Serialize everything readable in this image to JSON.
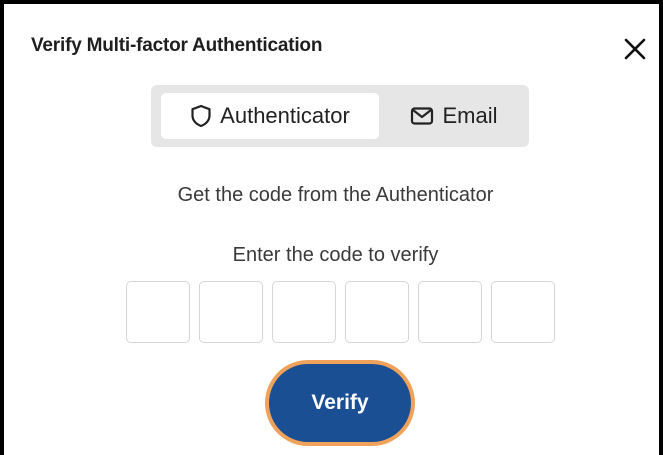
{
  "dialog": {
    "title": "Verify Multi-factor Authentication",
    "close_icon": "close-icon"
  },
  "method_tabs": [
    {
      "label": "Authenticator",
      "icon": "shield-icon",
      "selected": true
    },
    {
      "label": "Email",
      "icon": "mail-icon",
      "selected": false
    }
  ],
  "instructions": {
    "source_text": "Get the code from the Authenticator",
    "enter_text": "Enter the code to verify"
  },
  "code_inputs": [
    "",
    "",
    "",
    "",
    "",
    ""
  ],
  "verify_button": {
    "label": "Verify"
  },
  "colors": {
    "accent": "#1b4f93",
    "focus_ring": "#f0a25a",
    "segment_bg": "#e6e6e6"
  }
}
